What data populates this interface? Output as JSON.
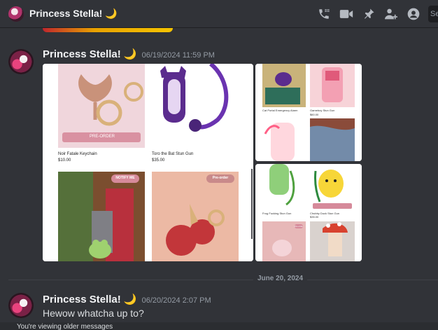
{
  "header": {
    "title": "Princess Stella! 🌙",
    "search_label": "Se",
    "icons": [
      "call-icon",
      "video-icon",
      "pin-icon",
      "add-friend-icon",
      "profile-icon"
    ]
  },
  "messages": [
    {
      "username": "Princess Stella! 🌙",
      "timestamp": "06/19/2024 11:59 PM",
      "attachments": [
        {
          "products": [
            {
              "name": "Noir Fatale Keychain",
              "price": "$10.00",
              "button": "PRE-ORDER"
            },
            {
              "name": "Toro the Bat Stun Gun",
              "price": "$35.00"
            }
          ],
          "badges": [
            "NOTIFY ME",
            "Pre-order"
          ]
        },
        {
          "products": [
            {
              "name": "Cat Portal Emergency Alarm"
            },
            {
              "name": "Gameboy Stun Gun",
              "price": "$60.00"
            }
          ]
        },
        {
          "products": [
            {
              "name": "Frog Fucking Stun Gun"
            },
            {
              "name": "Chubby Duck Stun Gun",
              "price": "$35.00"
            }
          ],
          "badges": [
            "Pre-order"
          ]
        }
      ]
    },
    {
      "username": "Princess Stella! 🌙",
      "timestamp": "06/20/2024 2:07 PM",
      "text": "Hewow whatcha up to?"
    }
  ],
  "date_divider": "June 20, 2024",
  "older_messages_banner": "You're viewing older messages",
  "colors": {
    "background": "#313338",
    "accent_purple": "#5b2c8e",
    "chip_pink": "#d68a9a"
  }
}
